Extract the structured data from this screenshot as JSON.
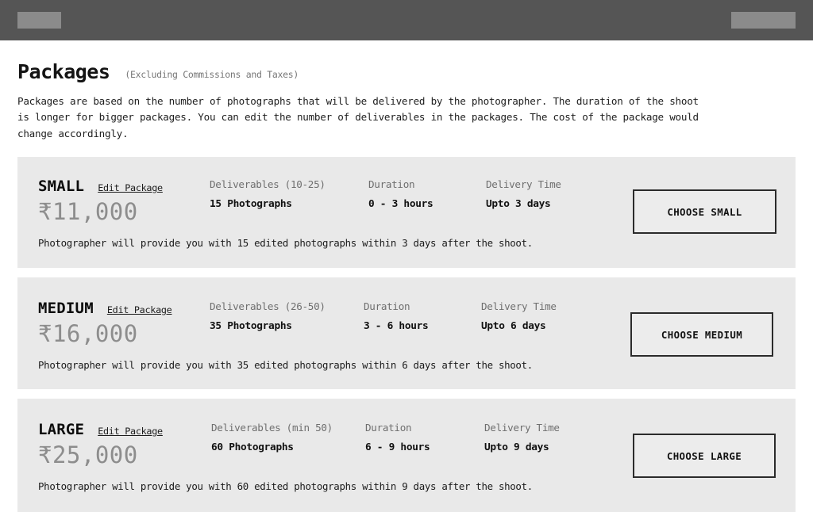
{
  "topbar": {
    "left_placeholder": "",
    "right_placeholder": "",
    "background_color": "#555555",
    "block_color": "#8b8b8b"
  },
  "header": {
    "title": "Packages",
    "subtitle": "(Excluding Commissions and Taxes)",
    "description": "Packages are based on the number of photographs that will be delivered by the photographer. The duration of the shoot is longer for bigger packages. You can edit the number of deliverables in the packages. The cost of the package would change accordingly."
  },
  "labels": {
    "edit_package": "Edit Package",
    "duration": "Duration",
    "delivery_time": "Delivery Time"
  },
  "packages": [
    {
      "name": "SMALL",
      "edit_label": "Edit Package",
      "price": "₹11,000",
      "deliverables_label": "Deliverables (10-25)",
      "deliverables_value": "15 Photographs",
      "duration_label": "Duration",
      "duration_value": "0 - 3 hours",
      "delivery_label": "Delivery Time",
      "delivery_value": "Upto 3 days",
      "note": "Photographer will provide you with 15 edited photographs within 3 days after the shoot.",
      "choose_label": "CHOOSE SMALL"
    },
    {
      "name": "MEDIUM",
      "edit_label": "Edit Package",
      "price": "₹16,000",
      "deliverables_label": "Deliverables (26-50)",
      "deliverables_value": "35 Photographs",
      "duration_label": "Duration",
      "duration_value": "3 - 6 hours",
      "delivery_label": "Delivery Time",
      "delivery_value": "Upto 6 days",
      "note": "Photographer will provide you with 35 edited photographs within 6 days after the shoot.",
      "choose_label": "CHOOSE MEDIUM"
    },
    {
      "name": "LARGE",
      "edit_label": "Edit Package",
      "price": "₹25,000",
      "deliverables_label": "Deliverables (min 50)",
      "deliverables_value": "60 Photographs",
      "duration_label": "Duration",
      "duration_value": "6 - 9 hours",
      "delivery_label": "Delivery Time",
      "delivery_value": "Upto 9 days",
      "note": "Photographer will provide you with 60 edited photographs within 9 days after the shoot.",
      "choose_label": "CHOOSE LARGE"
    }
  ],
  "colors": {
    "card_background": "#e9e9e9",
    "page_background": "#ffffff",
    "price_text": "#8d8d8d",
    "label_text": "#6f6f6f",
    "value_text": "#111111",
    "button_border": "#2b2b2b"
  }
}
